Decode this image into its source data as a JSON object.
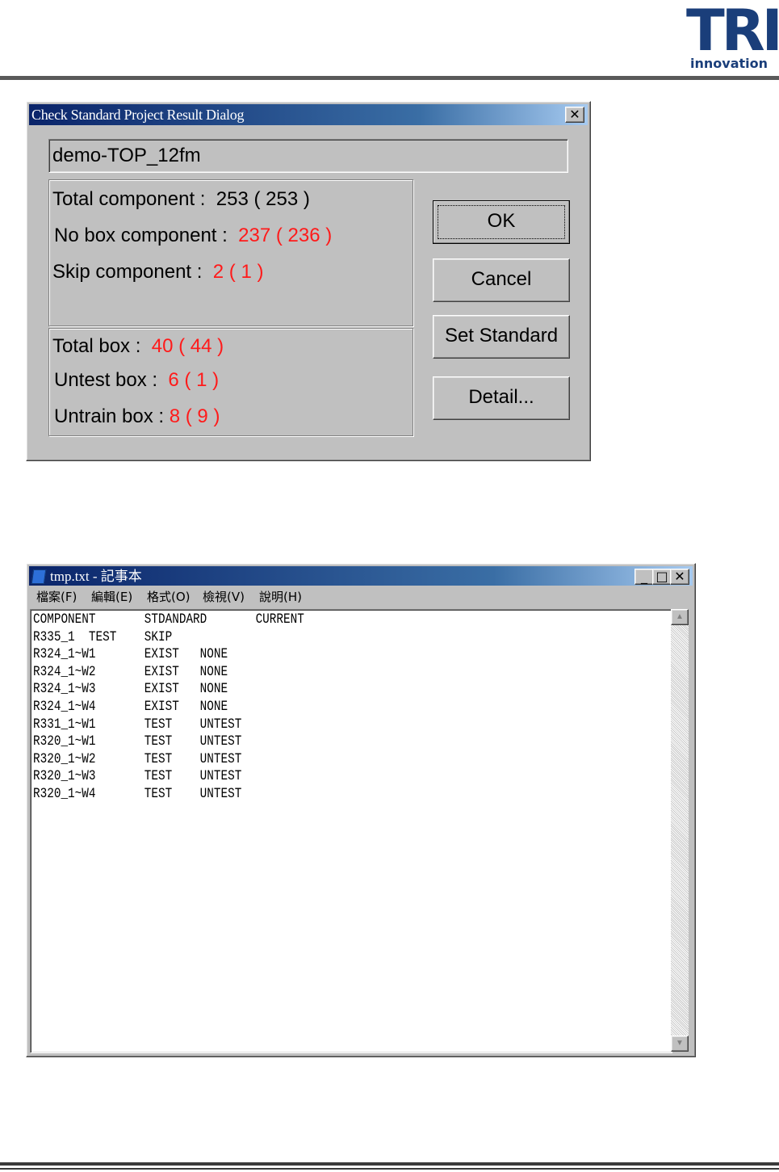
{
  "header": {
    "logo_text": "TRI",
    "logo_subtext": "innovation"
  },
  "dialog": {
    "title": "Check Standard Project Result Dialog",
    "close_glyph": "✕",
    "project_name": "demo-TOP_12fm",
    "stats": {
      "total_component": {
        "label": "Total component :",
        "value": "253 ( 253 )"
      },
      "no_box_component": {
        "label": "No box component :",
        "value": "237 ( 236 )"
      },
      "skip_component": {
        "label": "Skip component :",
        "value": "2 ( 1 )"
      },
      "total_box": {
        "label": "Total box :",
        "value": "40 ( 44 )"
      },
      "untest_box": {
        "label": "Untest box :",
        "value": "6 ( 1 )"
      },
      "untrain_box": {
        "label": "Untrain box :",
        "value": "8 ( 9 )"
      }
    },
    "buttons": {
      "ok": "OK",
      "cancel": "Cancel",
      "set_standard": "Set Standard",
      "detail": "Detail..."
    },
    "colors": {
      "highlight_value": "#ff1a1a",
      "title_bar": "#0a246a"
    }
  },
  "notepad": {
    "title": "tmp.txt - 記事本",
    "window_buttons": {
      "minimize": "_",
      "maximize": "□",
      "close": "✕"
    },
    "menu": [
      "檔案(F)",
      "編輯(E)",
      "格式(O)",
      "檢視(V)",
      "說明(H)"
    ],
    "content": "COMPONENT       STDANDARD       CURRENT\nR335_1  TEST    SKIP\nR324_1~W1       EXIST   NONE\nR324_1~W2       EXIST   NONE\nR324_1~W3       EXIST   NONE\nR324_1~W4       EXIST   NONE\nR331_1~W1       TEST    UNTEST\nR320_1~W1       TEST    UNTEST\nR320_1~W2       TEST    UNTEST\nR320_1~W3       TEST    UNTEST\nR320_1~W4       TEST    UNTEST",
    "scroll_up": "▲",
    "scroll_down": "▼"
  }
}
